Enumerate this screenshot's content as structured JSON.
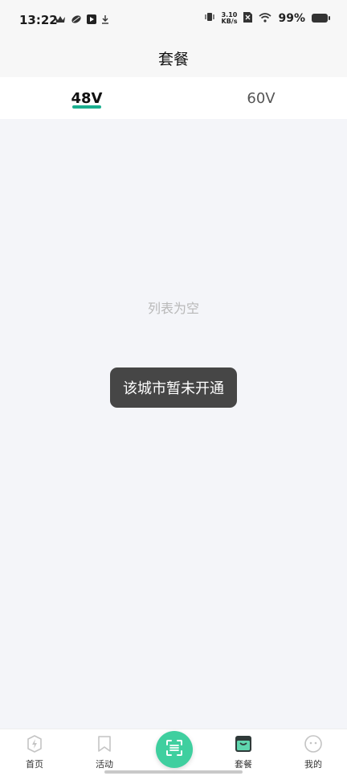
{
  "status_bar": {
    "time": "13:22",
    "net_speed_value": "3.10",
    "net_speed_unit": "KB/s",
    "battery_text": "99%",
    "left_icons": [
      "crown-icon",
      "leaf-icon",
      "play-app-icon",
      "download-icon"
    ],
    "right_icons": [
      "vibrate-icon",
      "no-sim-icon",
      "wifi-icon",
      "battery-icon"
    ]
  },
  "header": {
    "title": "套餐"
  },
  "tabs": [
    {
      "label": "48V",
      "active": true
    },
    {
      "label": "60V",
      "active": false
    }
  ],
  "content": {
    "empty_text": "列表为空",
    "toast_text": "该城市暂未开通"
  },
  "bottom_nav": {
    "items": [
      {
        "label": "首页",
        "icon": "bolt-icon"
      },
      {
        "label": "活动",
        "icon": "bookmark-icon"
      },
      {
        "label": "套餐",
        "icon": "package-bag-icon",
        "active": true
      },
      {
        "label": "我的",
        "icon": "face-icon"
      }
    ],
    "center_icon": "scan-icon"
  },
  "colors": {
    "accent": "#1aaf8f",
    "scan_button": "#3fcf9f",
    "toast_bg": "#464646",
    "empty_text": "#b8b8b8"
  }
}
